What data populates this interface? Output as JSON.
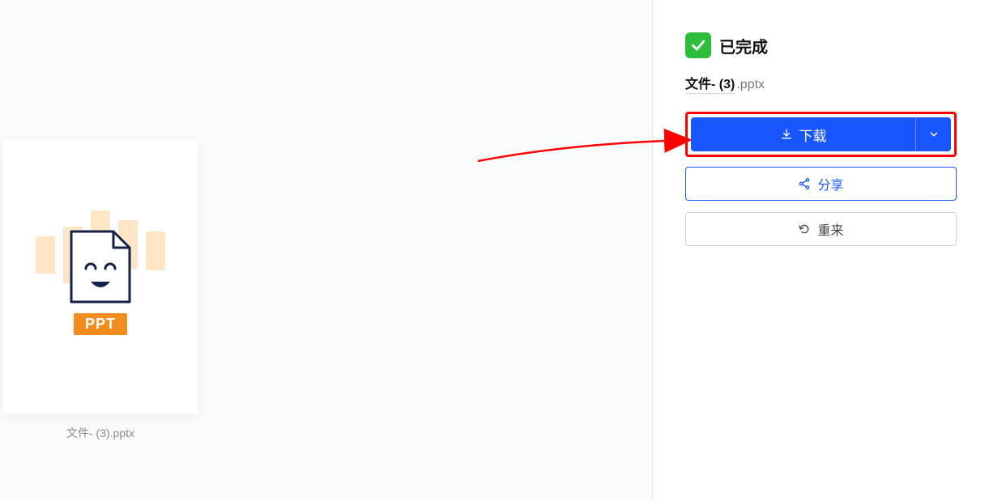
{
  "left": {
    "file_caption": "文件- (3).pptx",
    "badge": "PPT"
  },
  "right": {
    "status": "已完成",
    "filename_base": "文件- (3)",
    "filename_ext": ".pptx",
    "download_label": "下载",
    "share_label": "分享",
    "retry_label": "重来"
  },
  "colors": {
    "primary_blue": "#1a56ff",
    "success_green": "#2dbd3a",
    "highlight_red": "#ff0000",
    "ppt_orange": "#f28c1f"
  }
}
